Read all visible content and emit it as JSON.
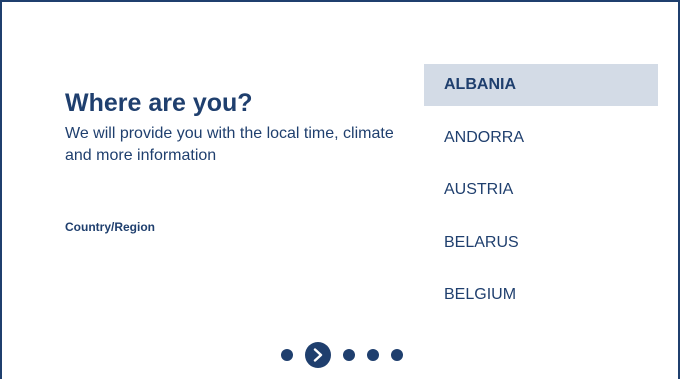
{
  "header": {
    "title": "Where are you?",
    "subtitle": "We will provide you with the local time, climate and more information"
  },
  "field": {
    "label": "Country/Region"
  },
  "countries": {
    "selected_index": 0,
    "items": [
      {
        "label": "ALBANIA"
      },
      {
        "label": "ANDORRA"
      },
      {
        "label": "AUSTRIA"
      },
      {
        "label": "BELARUS"
      },
      {
        "label": "BELGIUM"
      }
    ]
  },
  "pager": {
    "total_steps": 5,
    "current_step": 2,
    "active_icon": "chevron-right-icon"
  },
  "colors": {
    "primary": "#1f3f6e",
    "selected_background": "#d3dbe6",
    "background": "#ffffff"
  }
}
